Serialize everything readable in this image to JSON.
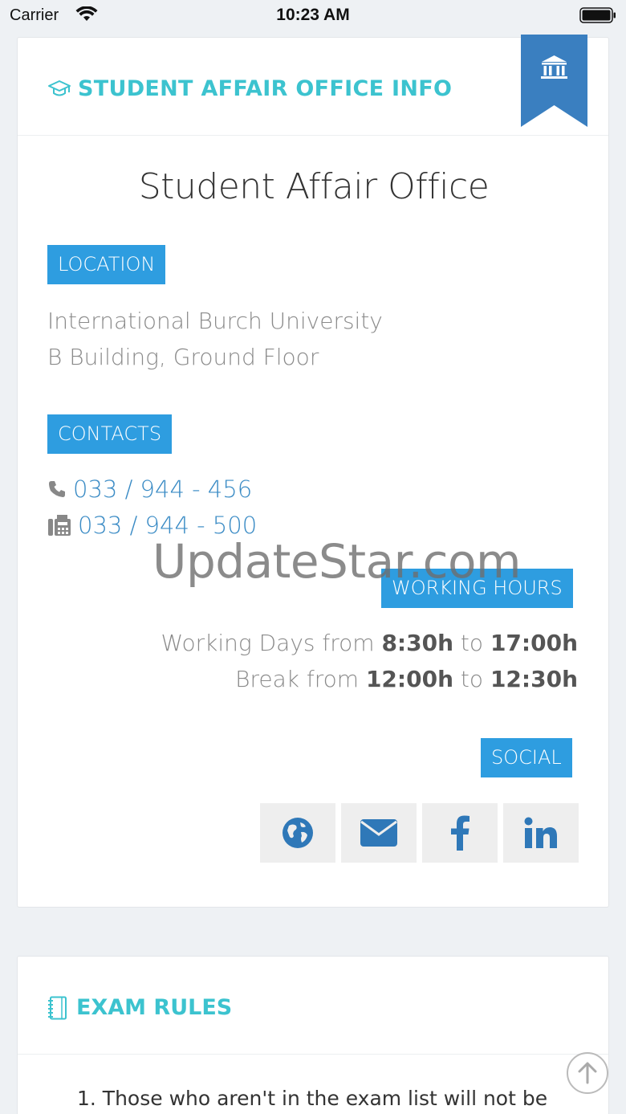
{
  "status_bar": {
    "carrier": "Carrier",
    "time": "10:23 AM"
  },
  "info_card": {
    "header_title": "STUDENT AFFAIR OFFICE INFO",
    "header_icon": "graduation-cap-icon",
    "ribbon_icon": "institution-icon",
    "office_name": "Student Affair Office",
    "location": {
      "label": "LOCATION",
      "line1": "International Burch University",
      "line2": "B Building, Ground Floor"
    },
    "contacts": {
      "label": "CONTACTS",
      "phone": "033 / 944 - 456",
      "fax": "033 / 944 - 500"
    },
    "working_hours": {
      "label": "WORKING HOURS",
      "days_prefix": "Working Days from ",
      "days_start": "8:30h",
      "days_mid": " to ",
      "days_end": "17:00h",
      "break_prefix": "Break from ",
      "break_start": "12:00h",
      "break_mid": " to ",
      "break_end": "12:30h"
    },
    "social": {
      "label": "SOCIAL",
      "icons": [
        "globe-icon",
        "envelope-icon",
        "facebook-icon",
        "linkedin-icon"
      ]
    }
  },
  "watermark": "UpdateStar.com",
  "exam_card": {
    "title": "EXAM RULES",
    "rule_1": "1.  Those who aren't in the exam list will not be"
  },
  "colors": {
    "accent_teal": "#3cc3cf",
    "tag_blue": "#2e9de0",
    "link_blue": "#3a8bc5",
    "ribbon_blue": "#3a7fc0"
  }
}
